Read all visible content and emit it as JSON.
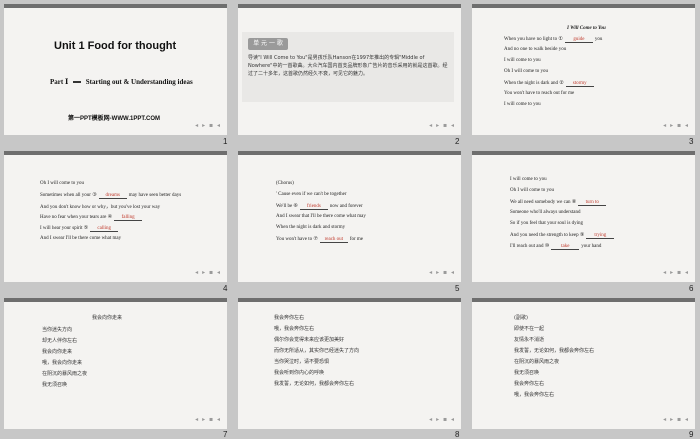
{
  "slides": [
    {
      "number": "1",
      "title": "Unit 1     Food for thought",
      "part": "Part",
      "part_mark": "Ⅰ",
      "subtitle": "Starting out & Understanding  ideas",
      "website": "第一PPT模板网-WWW.1PPT.COM"
    },
    {
      "number": "2",
      "badge": "单 元 一 歌",
      "paragraph": "导读\"I Will Come to You\"是男孩乐队Hanson在1997年推出的专辑\"Middle of Nowhere\"中的一首歌曲。大众汽车国内首支品牌形象广告片的音乐采用的就是这首歌。经过了二十多年，这首歌仍然经久不衰，可见它的魅力。"
    },
    {
      "number": "3",
      "song_title": "I Will Come to You",
      "lines": [
        {
          "pre": "When you have no light to ①",
          "blank": "guide",
          "post": "you"
        },
        {
          "pre": "And no one to walk beside you",
          "blank": "",
          "post": ""
        },
        {
          "pre": "I will come to you",
          "blank": "",
          "post": ""
        },
        {
          "pre": "Oh I will come to you",
          "blank": "",
          "post": ""
        },
        {
          "pre": "When the night is dark and ②",
          "blank": "stormy",
          "post": ""
        },
        {
          "pre": "You won't have to reach out for  me",
          "blank": "",
          "post": ""
        },
        {
          "pre": "I will come to you",
          "blank": "",
          "post": ""
        }
      ]
    },
    {
      "number": "4",
      "lines": [
        {
          "pre": "Oh I will come to you",
          "blank": "",
          "post": ""
        },
        {
          "pre": "Sometimes when all your ③",
          "blank": "dreams",
          "post": "may have seen better days"
        },
        {
          "pre": "And you don't know how or why，but you've lost your way",
          "blank": "",
          "post": ""
        },
        {
          "pre": "Have no fear  when your tears are ④",
          "blank": "falling",
          "post": ""
        },
        {
          "pre": "I will hear your spirit ⑤",
          "blank": "calling",
          "post": ""
        },
        {
          "pre": "And I swear I'll be there come what may",
          "blank": "",
          "post": ""
        }
      ]
    },
    {
      "number": "5",
      "lines": [
        {
          "pre": "(Chorus)",
          "blank": "",
          "post": ""
        },
        {
          "pre": "' Cause even if we can't be together",
          "blank": "",
          "post": ""
        },
        {
          "pre": "We'll be ⑥",
          "blank": "friends",
          "post": "now and forever"
        },
        {
          "pre": "And I swear that I'll be there come what may",
          "blank": "",
          "post": ""
        },
        {
          "pre": "When the night is dark and stormy",
          "blank": "",
          "post": ""
        },
        {
          "pre": "You won't have to ⑦",
          "blank": "reach out",
          "post": "for me"
        }
      ]
    },
    {
      "number": "6",
      "lines": [
        {
          "pre": "I will come to you",
          "blank": "",
          "post": ""
        },
        {
          "pre": "Oh I will come to you",
          "blank": "",
          "post": ""
        },
        {
          "pre": "We all need somebody we can ⑧",
          "blank": "turn to",
          "post": ""
        },
        {
          "pre": "Someone who'll always understand",
          "blank": "",
          "post": ""
        },
        {
          "pre": "So if you feel  that your soul is dying",
          "blank": "",
          "post": ""
        },
        {
          "pre": "And you need  the strength to keep ⑨",
          "blank": "trying",
          "post": ""
        },
        {
          "pre": "I'll reach  out and ⑩",
          "blank": "take",
          "post": "your hand"
        }
      ]
    },
    {
      "number": "7",
      "title": "我会向你走来",
      "lines": [
        "当你迷失方向",
        "却无人伴你左右",
        "我会向你走来",
        "哦，我会向你走来",
        "在阴沉的暴风雨之夜",
        "我无须召唤"
      ]
    },
    {
      "number": "8",
      "lines": [
        "我会奔你左右",
        "哦，我会奔你左右",
        "偶尔你会觉得未来应该更加美好",
        "而你无所适从，其实你已经迷失了方向",
        "当你哭泣时，请不要恐惧",
        "我会听到你内心的呼唤",
        "我发誓，无论如何，我都会奔你左右"
      ]
    },
    {
      "number": "9",
      "lines": [
        "(副歌)",
        "即使不在一起",
        "友情永不消逝",
        "我发誓，无论如何，我都会奔你左右",
        "在阴沉的暴风雨之夜",
        "我无须召唤",
        "我会奔你左右",
        "哦，我会奔你左右"
      ]
    }
  ],
  "nav_icons": "◂ ▸ ▪ ◂"
}
